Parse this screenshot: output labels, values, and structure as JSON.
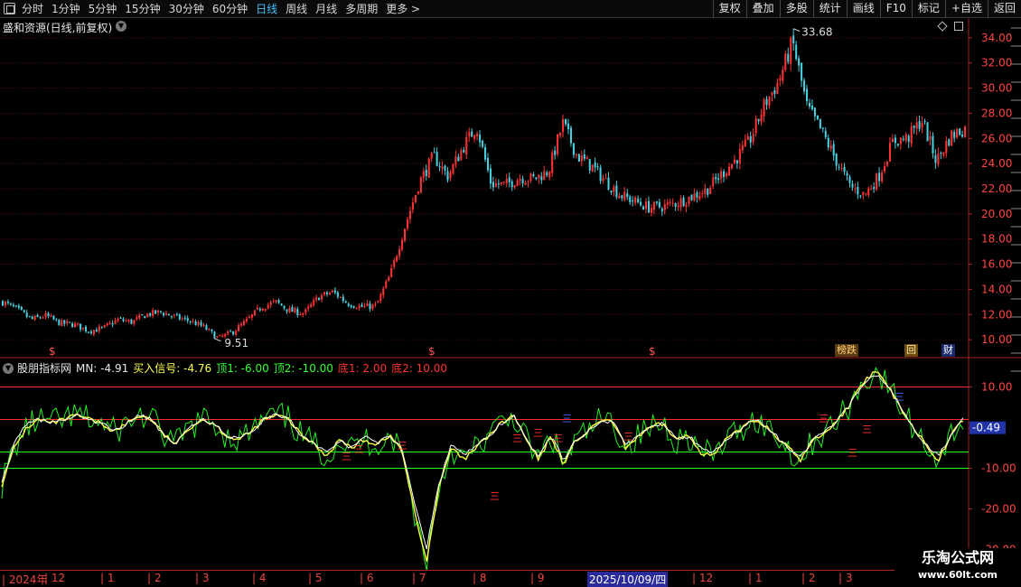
{
  "toolbar": {
    "periods": [
      {
        "label": "分时",
        "active": false
      },
      {
        "label": "1分钟",
        "active": false
      },
      {
        "label": "5分钟",
        "active": false
      },
      {
        "label": "15分钟",
        "active": false
      },
      {
        "label": "30分钟",
        "active": false
      },
      {
        "label": "60分钟",
        "active": false
      },
      {
        "label": "日线",
        "active": true
      },
      {
        "label": "周线",
        "active": false
      },
      {
        "label": "月线",
        "active": false
      },
      {
        "label": "多周期",
        "active": false
      },
      {
        "label": "更多 >",
        "active": false
      }
    ],
    "buttons": [
      "复权",
      "叠加",
      "多股",
      "统计",
      "画线",
      "F10",
      "标记",
      "+自选",
      "返回"
    ]
  },
  "stock": {
    "title": "盛和资源(日线,前复权)",
    "high_label": "33.68",
    "low_label": "9.51"
  },
  "indicator": {
    "name": "股朋指标网",
    "items": [
      {
        "text": "MN: -4.91",
        "color": "white"
      },
      {
        "text": "买入信号: -4.76",
        "color": "yellow"
      },
      {
        "text": "顶1: -6.00",
        "color": "green"
      },
      {
        "text": "顶2: -10.00",
        "color": "green"
      },
      {
        "text": "底1: 2.00",
        "color": "red"
      },
      {
        "text": "底2: 10.00",
        "color": "red"
      }
    ],
    "current_value_label": "-0.49",
    "signal_char": "三"
  },
  "badges": {
    "bang": "榜跌",
    "hui": "回",
    "cai": "财"
  },
  "markers": {
    "dollar": "$"
  },
  "time_axis": {
    "labels": [
      "2024年",
      "12",
      "1",
      "2",
      "3",
      "4",
      "5",
      "6",
      "7",
      "8",
      "9",
      "12",
      "1",
      "2",
      "3"
    ],
    "cursor_date": "2025/10/09/四"
  },
  "watermark": {
    "name": "乐淘公式网",
    "url": "www.60lt.com"
  },
  "chart_data": [
    {
      "type": "candlestick",
      "title": "盛和资源(日线,前复权)",
      "ylim": [
        8.5,
        35.5
      ],
      "y_ticks": [
        10.0,
        12.0,
        14.0,
        16.0,
        18.0,
        20.0,
        22.0,
        24.0,
        26.0,
        28.0,
        30.0,
        32.0,
        34.0
      ],
      "x_ticks": [
        "2024年",
        "12",
        "1",
        "2",
        "3",
        "4",
        "5",
        "6",
        "7",
        "8",
        "9",
        "2025/10/09/四",
        "12",
        "1",
        "2",
        "3"
      ],
      "grid": true,
      "annotations": [
        {
          "text": "33.68",
          "kind": "high"
        },
        {
          "text": "9.51",
          "kind": "low"
        }
      ],
      "close_series": [
        13.0,
        12.4,
        11.6,
        11.9,
        11.3,
        11.2,
        10.7,
        10.9,
        11.6,
        11.4,
        12.0,
        12.2,
        11.8,
        11.5,
        11.0,
        10.1,
        10.6,
        11.5,
        12.6,
        13.0,
        12.3,
        12.1,
        13.4,
        13.8,
        12.9,
        12.6,
        12.7,
        15.2,
        19.0,
        22.5,
        24.6,
        23.0,
        25.2,
        27.0,
        22.4,
        22.3,
        22.9,
        22.8,
        23.4,
        27.2,
        24.6,
        23.8,
        22.6,
        21.5,
        21.0,
        20.5,
        20.6,
        20.9,
        21.4,
        21.9,
        23.1,
        24.3,
        25.8,
        28.6,
        30.5,
        33.68,
        28.5,
        26.6,
        24.3,
        22.2,
        21.5,
        23.0,
        25.8,
        26.0,
        27.5,
        24.2,
        26.2,
        26.8
      ]
    },
    {
      "type": "line",
      "title": "股朋指标网",
      "ylim": [
        -35,
        17
      ],
      "y_ticks": [
        10.0,
        0.0,
        -10.0,
        -20.0,
        -30.0
      ],
      "reference_lines": [
        {
          "name": "底2",
          "value": 10.0
        },
        {
          "name": "底1",
          "value": 2.0
        },
        {
          "name": "顶1",
          "value": -6.0
        },
        {
          "name": "顶2",
          "value": -10.0
        }
      ],
      "series": [
        {
          "name": "MN",
          "values": [
            -13,
            -4,
            1,
            2,
            1,
            2,
            3,
            2,
            1,
            -1,
            1,
            3,
            2,
            -2,
            -4,
            0,
            2,
            1,
            -2,
            -3,
            -1,
            2,
            3,
            2,
            -2,
            -4,
            -6,
            -3,
            -5,
            -2,
            -4,
            -2,
            -5,
            -18,
            -30,
            -14,
            -4,
            -7,
            -4,
            -2,
            1,
            3,
            -3,
            -7,
            -2,
            -8,
            -3,
            -1,
            2,
            1,
            -4,
            -2,
            0,
            1,
            -3,
            -2,
            -5,
            -6,
            -3,
            -1,
            2,
            1,
            -2,
            -5,
            -7,
            -3,
            -1,
            2,
            6,
            11,
            13,
            10,
            5,
            0,
            -4,
            -7,
            -2,
            2
          ]
        },
        {
          "name": "买入信号",
          "values": [
            -14,
            -5,
            0,
            2,
            1,
            2,
            3,
            2,
            1,
            -1,
            1,
            3,
            2,
            -2,
            -4,
            0,
            2,
            1,
            -2,
            -3,
            -1,
            2,
            3,
            2,
            -2,
            -4,
            -7,
            -3,
            -5,
            -3,
            -4,
            -2,
            -5,
            -20,
            -33,
            -15,
            -5,
            -8,
            -5,
            -2,
            1,
            3,
            -3,
            -8,
            -2,
            -9,
            -3,
            -1,
            2,
            1,
            -5,
            -2,
            0,
            1,
            -3,
            -2,
            -6,
            -7,
            -3,
            -1,
            2,
            1,
            -2,
            -5,
            -8,
            -3,
            -1,
            2,
            6,
            11,
            14,
            10,
            5,
            0,
            -4,
            -8,
            -2,
            2
          ]
        }
      ]
    }
  ],
  "colors": {
    "up": "#ff3333",
    "down": "#45d0e0",
    "grid": "#5a1010",
    "axis": "#aa2222",
    "mn_line": "#ffffff",
    "signal_line": "#ffff40",
    "ref_green": "#22ff22",
    "ref_red": "#ff2a2a",
    "spike": "#22ee22"
  }
}
